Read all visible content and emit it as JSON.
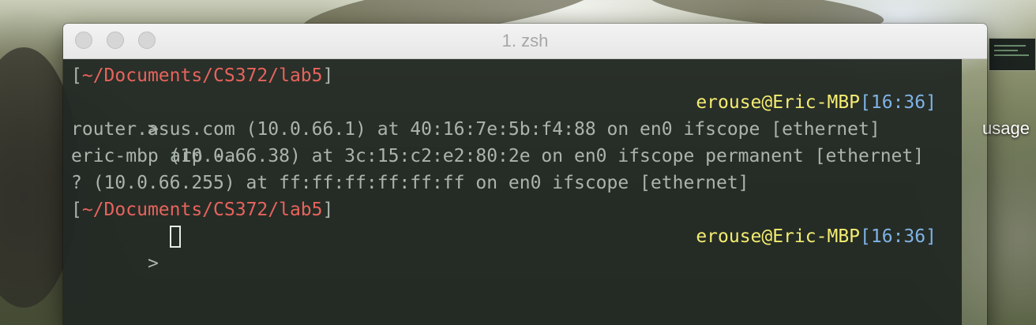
{
  "window": {
    "title": "1. zsh"
  },
  "desktop": {
    "partial_label": "usage"
  },
  "terminal": {
    "prompt1": {
      "bracket_open": "[",
      "path": "~/Documents/CS372/lab5",
      "bracket_close": "]",
      "chevron": ">",
      "command": "arp -a",
      "user_host": "erouse@Eric-MBP",
      "time_open": "[",
      "time": "16:36",
      "time_close": "]"
    },
    "output": [
      "router.asus.com (10.0.66.1) at 40:16:7e:5b:f4:88 on en0 ifscope [ethernet]",
      "eric-mbp (10.0.66.38) at 3c:15:c2:e2:80:2e on en0 ifscope permanent [ethernet]",
      "? (10.0.66.255) at ff:ff:ff:ff:ff:ff on en0 ifscope [ethernet]"
    ],
    "prompt2": {
      "bracket_open": "[",
      "path": "~/Documents/CS372/lab5",
      "bracket_close": "]",
      "chevron": ">",
      "user_host": "erouse@Eric-MBP",
      "time_open": "[",
      "time": "16:36",
      "time_close": "]"
    }
  },
  "colors": {
    "path": "#e8635d",
    "user_host": "#f3ec72",
    "time": "#7fb3e6",
    "text": "#aab4ad",
    "terminal_bg": "#212823"
  }
}
